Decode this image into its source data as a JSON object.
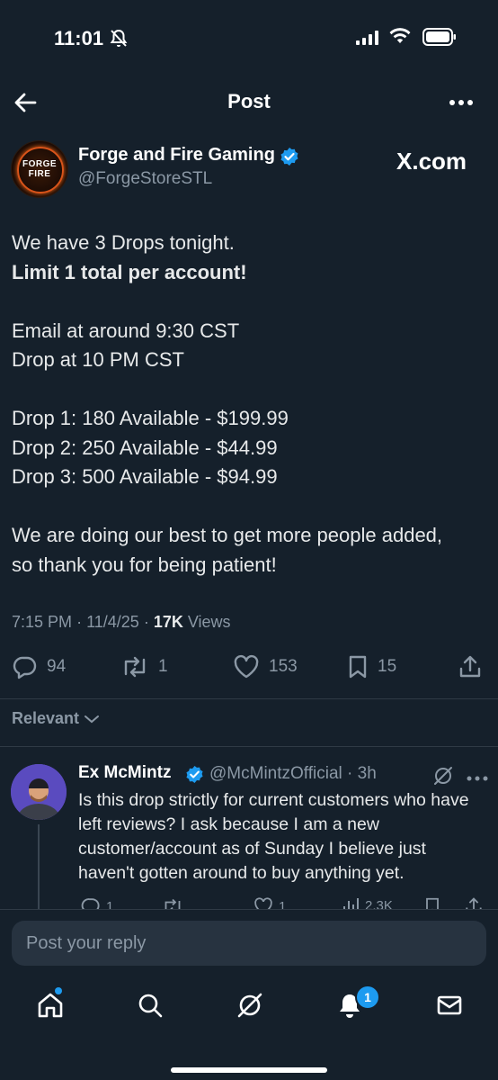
{
  "status_bar": {
    "time": "11:01"
  },
  "header": {
    "title": "Post"
  },
  "post": {
    "author_name": "Forge and Fire Gaming",
    "author_handle": "@ForgeStoreSTL",
    "avatar_text_top": "FORGE",
    "avatar_text_bottom": "FIRE",
    "badge_text": "X.com",
    "lines": {
      "l1": "We have 3 Drops tonight.",
      "l2": "Limit 1 total per account!",
      "l3": "Email at around 9:30 CST",
      "l4": "Drop at 10 PM CST",
      "l5": "Drop 1: 180 Available - $199.99",
      "l6": "Drop 2: 250 Available - $44.99",
      "l7": "Drop 3: 500 Available - $94.99",
      "l8": "We are doing our best to get more people added,",
      "l9": "so thank you for being patient!"
    },
    "time": "7:15 PM",
    "date": "11/4/25",
    "views_count": "17K",
    "views_label": "Views",
    "replies": "94",
    "reposts": "1",
    "likes": "153",
    "bookmarks": "15"
  },
  "sort": {
    "label": "Relevant"
  },
  "reply": {
    "name": "Ex McMintz",
    "handle": "@McMintzOfficial",
    "age": "3h",
    "text": "Is this drop strictly for current customers who have left reviews? I ask because I am a new customer/account as of Sunday I believe just haven't gotten around to buy anything yet.",
    "replies": "1",
    "likes": "1",
    "views": "2.3K"
  },
  "composer": {
    "placeholder": "Post your reply"
  },
  "nav": {
    "notifications_badge": "1"
  },
  "colors": {
    "background": "#15202b",
    "accent": "#1d9bf0",
    "muted": "#8b98a5"
  }
}
